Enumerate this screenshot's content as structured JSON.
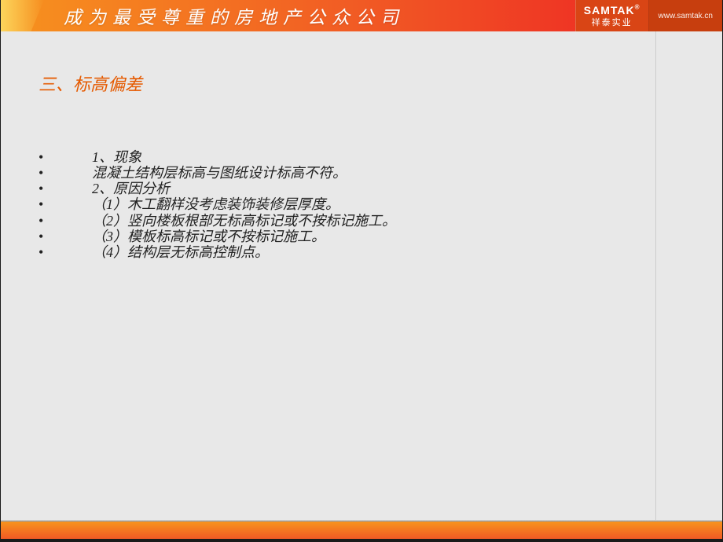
{
  "header": {
    "slogan": "成为最受尊重的房地产公众公司",
    "logo": {
      "name": "SAMTAK",
      "reg": "®",
      "subtitle": "祥泰实业",
      "url": "www.samtak.cn"
    }
  },
  "section": {
    "title": "三、标高偏差"
  },
  "body": {
    "items": [
      "1、现象",
      "混凝土结构层标高与图纸设计标高不符。",
      "2、原因分析",
      "（1）木工翻样没考虑装饰装修层厚度。",
      "（2）竖向楼板根部无标高标记或不按标记施工。",
      "（3）模板标高标记或不按标记施工。",
      "（4）结构层无标高控制点。"
    ]
  }
}
